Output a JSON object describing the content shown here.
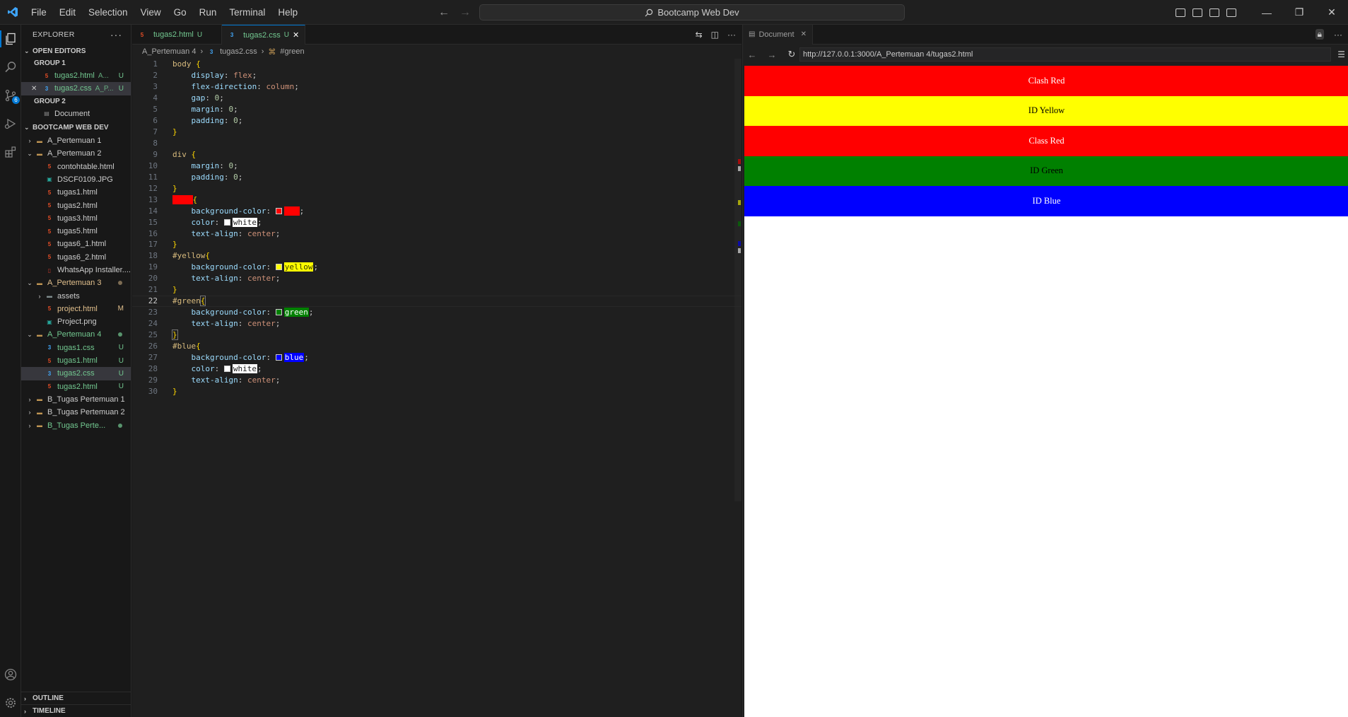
{
  "titlebar": {
    "menu": [
      "File",
      "Edit",
      "Selection",
      "View",
      "Go",
      "Run",
      "Terminal",
      "Help"
    ],
    "search_text": "Bootcamp Web Dev"
  },
  "activity": {
    "scm_badge": "6"
  },
  "explorer": {
    "title": "EXPLORER",
    "open_editors_label": "OPEN EDITORS",
    "group1_label": "GROUP 1",
    "group1_items": [
      {
        "name": "tugas2.html",
        "desc": "A...",
        "status": "U"
      },
      {
        "name": "tugas2.css",
        "desc": "A_P...",
        "status": "U"
      }
    ],
    "group2_label": "GROUP 2",
    "group2_items": [
      {
        "name": "Document"
      }
    ],
    "workspace_label": "BOOTCAMP WEB DEV",
    "tree": {
      "p1": "A_Pertemuan 1",
      "p2": "A_Pertemuan 2",
      "p2_files": [
        "contohtable.html",
        "DSCF0109.JPG",
        "tugas1.html",
        "tugas2.html",
        "tugas3.html",
        "tugas5.html",
        "tugas6_1.html",
        "tugas6_2.html",
        "WhatsApp Installer...."
      ],
      "p3": "A_Pertemuan 3",
      "p3_assets": "assets",
      "p3_project": "project.html",
      "p3_project_status": "M",
      "p3_png": "Project.png",
      "p4": "A_Pertemuan 4",
      "p4_files": [
        {
          "name": "tugas1.css",
          "status": "U"
        },
        {
          "name": "tugas1.html",
          "status": "U"
        },
        {
          "name": "tugas2.css",
          "status": "U"
        },
        {
          "name": "tugas2.html",
          "status": "U"
        }
      ],
      "b1": "B_Tugas Pertemuan 1",
      "b2": "B_Tugas Pertemuan 2",
      "b3": "B_Tugas Perte..."
    },
    "outline_label": "OUTLINE",
    "timeline_label": "TIMELINE"
  },
  "editor": {
    "tabs": [
      {
        "name": "tugas2.html",
        "status": "U"
      },
      {
        "name": "tugas2.css",
        "status": "U"
      }
    ],
    "breadcrumb": {
      "folder": "A_Pertemuan 4",
      "file": "tugas2.css",
      "symbol": "#green"
    },
    "line_numbers": [
      "1",
      "2",
      "3",
      "4",
      "5",
      "6",
      "7",
      "8",
      "9",
      "10",
      "11",
      "12",
      "13",
      "14",
      "15",
      "16",
      "17",
      "18",
      "19",
      "20",
      "21",
      "22",
      "23",
      "24",
      "25",
      "26",
      "27",
      "28",
      "29",
      "30"
    ],
    "code": {
      "body_sel": "body",
      "display": "display",
      "flex": "flex",
      "flex_direction": "flex-direction",
      "column": "column",
      "gap": "gap",
      "margin": "margin",
      "padding": "padding",
      "zero": "0",
      "div_sel": "div",
      "red_sel": ".red",
      "background_color": "background-color",
      "color": "color",
      "text_align": "text-align",
      "red": "red",
      "white": "white",
      "center": "center",
      "yellow_sel": "#yellow",
      "yellow": "yellow",
      "green_sel": "#green",
      "green": "green",
      "blue_sel": "#blue",
      "blue": "blue"
    }
  },
  "preview": {
    "tab_title": "Document",
    "url": "http://127.0.0.1:3000/A_Pertemuan 4/tugas2.html",
    "divs": [
      {
        "text": "Clash Red",
        "bg": "#ff0000",
        "fg": "#ffffff"
      },
      {
        "text": "ID Yellow",
        "bg": "#ffff00",
        "fg": "#000000"
      },
      {
        "text": "Class Red",
        "bg": "#ff0000",
        "fg": "#ffffff"
      },
      {
        "text": "ID Green",
        "bg": "#008000",
        "fg": "#000000"
      },
      {
        "text": "ID Blue",
        "bg": "#0000ff",
        "fg": "#ffffff"
      }
    ]
  },
  "colors": {
    "accent": "#0078d4",
    "untracked": "#73c991",
    "modified": "#e2c08d"
  }
}
